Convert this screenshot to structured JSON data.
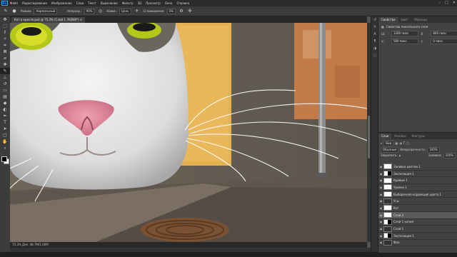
{
  "menubar": {
    "items": [
      "Файл",
      "Редактирование",
      "Изображение",
      "Слои",
      "Текст",
      "Выделение",
      "Фильтр",
      "3D",
      "Просмотр",
      "Окно",
      "Справка"
    ],
    "logo": "Ps"
  },
  "options": {
    "mode_label": "Режим:",
    "mode_value": "Нормальный",
    "opacity_label": "Непрозр.:",
    "opacity_value": "90%",
    "flow_label": "Нажм.:",
    "flow_value": "Цель",
    "smooth_label": "Сглаживание:",
    "smooth_value": "0%"
  },
  "document": {
    "tab": "Кот в кресле.psd @ 75,3% (Слой 1, RGB/8*) ✕"
  },
  "status": {
    "text": "75,3%    Док: 48,7M/1,00M"
  },
  "properties": {
    "tabs": [
      "Свойства",
      "Цвет",
      "Образцы"
    ],
    "title": "Свойства пиксельного слоя",
    "w_label": "Ш:",
    "w_value": "1280 пикс.",
    "h_label": "В:",
    "h_value": "800 пикс.",
    "x_label": "X:",
    "x_value": "580 пикс.",
    "y_label": "Y:",
    "y_value": "0 пикс."
  },
  "layers": {
    "tabs": [
      "Слои",
      "Каналы",
      "Контуры"
    ],
    "kind_label": "Вид",
    "blend_value": "Обычные",
    "opacity_label": "Непрозрачность:",
    "opacity_value": "100%",
    "lock_label": "Закрепить:",
    "fill_label": "Заливка:",
    "fill_value": "100%",
    "items": [
      {
        "name": "Заливка цветом 1"
      },
      {
        "name": "Экспозиция 1"
      },
      {
        "name": "Кривые 1"
      },
      {
        "name": "Уровни 1"
      },
      {
        "name": "Выборочная коррекция цвета 1"
      },
      {
        "name": "Усы"
      },
      {
        "name": "Кот"
      },
      {
        "name": "Слой 2"
      },
      {
        "name": "Слой 1 копия"
      },
      {
        "name": "Слой 1"
      },
      {
        "name": "Экспозиция 1"
      },
      {
        "name": "Фон"
      }
    ]
  }
}
